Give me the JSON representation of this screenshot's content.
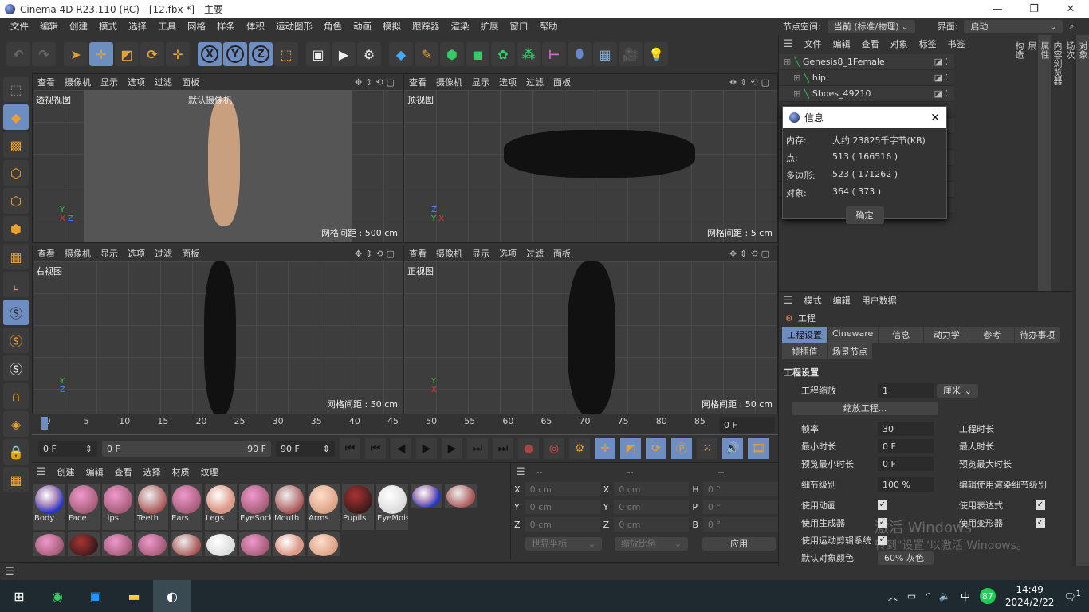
{
  "window": {
    "title": "Cinema 4D R23.110 (RC) - [12.fbx *] - 主要",
    "controls": [
      "—",
      "❐",
      "✕"
    ]
  },
  "menu": [
    "文件",
    "编辑",
    "创建",
    "模式",
    "选择",
    "工具",
    "网格",
    "样条",
    "体积",
    "运动图形",
    "角色",
    "动画",
    "模拟",
    "跟踪器",
    "渲染",
    "扩展",
    "窗口",
    "帮助"
  ],
  "node_space": {
    "label": "节点空间:",
    "value": "当前 (标准/物理)",
    "ui_label": "界面:",
    "ui_value": "启动"
  },
  "toolbar": {
    "axis_buttons": [
      "X",
      "Y",
      "Z"
    ]
  },
  "viewports": [
    {
      "menu": [
        "查看",
        "摄像机",
        "显示",
        "选项",
        "过滤",
        "面板"
      ],
      "name": "透视视图",
      "camera": "默认摄像机",
      "grid": "网格间距 : 500 cm"
    },
    {
      "menu": [
        "查看",
        "摄像机",
        "显示",
        "选项",
        "过滤",
        "面板"
      ],
      "name": "顶视图",
      "grid": "网格间距 : 5 cm"
    },
    {
      "menu": [
        "查看",
        "摄像机",
        "显示",
        "选项",
        "过滤",
        "面板"
      ],
      "name": "右视图",
      "grid": "网格间距 : 50 cm"
    },
    {
      "menu": [
        "查看",
        "摄像机",
        "显示",
        "选项",
        "过滤",
        "面板"
      ],
      "name": "正视图",
      "grid": "网格间距 : 50 cm"
    }
  ],
  "timeline": {
    "ticks": [
      "0",
      "5",
      "10",
      "15",
      "20",
      "25",
      "30",
      "35",
      "40",
      "45",
      "50",
      "55",
      "60",
      "65",
      "70",
      "75",
      "80",
      "85",
      "90"
    ],
    "current": "0 F",
    "start": "0 F",
    "range_start": "0 F",
    "range_end": "90 F",
    "end": "90 F",
    "frame_right": "0 F"
  },
  "materials": {
    "menu": [
      "创建",
      "编辑",
      "查看",
      "选择",
      "材质",
      "纹理"
    ],
    "items": [
      "Body",
      "Face",
      "Lips",
      "Teeth",
      "Ears",
      "Legs",
      "EyeSock",
      "Mouth",
      "Arms",
      "Pupils",
      "EyeMois"
    ]
  },
  "coordinates": {
    "headers": [
      "--",
      "--",
      "--"
    ],
    "rows": [
      [
        "X",
        "0 cm",
        "X",
        "0 cm",
        "H",
        "0 °"
      ],
      [
        "Y",
        "0 cm",
        "Y",
        "0 cm",
        "P",
        "0 °"
      ],
      [
        "Z",
        "0 cm",
        "Z",
        "0 cm",
        "B",
        "0 °"
      ]
    ],
    "mode": "世界坐标",
    "scale": "缩放比例",
    "apply": "应用"
  },
  "object_manager": {
    "menu": [
      "文件",
      "编辑",
      "查看",
      "对象",
      "标签",
      "书签"
    ],
    "objects": [
      "Genesis8_1Female",
      "hip",
      "Shoes_49210"
    ]
  },
  "info_dialog": {
    "title": "信息",
    "rows": [
      {
        "k": "内存:",
        "v": "大约 23825千字节(KB)"
      },
      {
        "k": "点:",
        "v": "513 ( 166516 )"
      },
      {
        "k": "多边形:",
        "v": "523 ( 171262 )"
      },
      {
        "k": "对象:",
        "v": "364 ( 373 )"
      }
    ],
    "ok": "确定"
  },
  "side_tabs_top": [
    "对象",
    "场次",
    "内容浏览器"
  ],
  "side_tabs_bottom": [
    "属性",
    "层",
    "构造"
  ],
  "attributes": {
    "menu": [
      "模式",
      "编辑",
      "用户数据"
    ],
    "object": "工程",
    "tabs": [
      "工程设置",
      "Cineware",
      "信息",
      "动力学",
      "参考",
      "待办事项",
      "帧插值",
      "场景节点"
    ],
    "section": "工程设置",
    "scale_label": "工程缩放",
    "scale_value": "1",
    "unit": "厘米",
    "scale_btn": "缩放工程...",
    "fields_left": [
      {
        "k": "帧率",
        "v": "30"
      },
      {
        "k": "最小时长",
        "v": "0 F"
      },
      {
        "k": "预览最小时长",
        "v": "0 F"
      }
    ],
    "fields_right": [
      "工程时长",
      "最大时长",
      "预览最大时长"
    ],
    "lod_label": "细节级别",
    "lod_value": "100 %",
    "lod_render": "编辑使用渲染细节级别",
    "checks_left": [
      "使用动画",
      "使用生成器",
      "使用运动剪辑系统"
    ],
    "checks_right": [
      "使用表达式",
      "使用变形器"
    ],
    "default_color_label": "默认对象颜色",
    "default_color_value": "60% 灰色"
  },
  "activation": [
    "激活 Windows",
    "转到\"设置\"以激活 Windows。"
  ],
  "taskbar": {
    "tray_lang": "中",
    "badge": "87",
    "time": "14:49",
    "date": "2024/2/22",
    "notif": "1"
  }
}
